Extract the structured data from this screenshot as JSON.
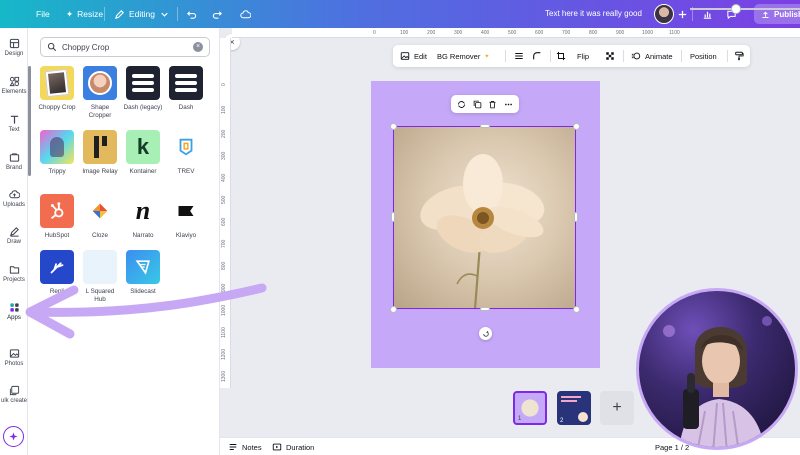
{
  "topbar": {
    "file": "File",
    "resize": "Resize",
    "editing": "Editing",
    "title": "Text here it was really good",
    "publish": "Publish as"
  },
  "rail": {
    "items": [
      {
        "label": "Design",
        "icon": "design-icon"
      },
      {
        "label": "Elements",
        "icon": "elements-icon"
      },
      {
        "label": "Text",
        "icon": "text-icon"
      },
      {
        "label": "Brand",
        "icon": "brand-icon"
      },
      {
        "label": "Uploads",
        "icon": "cloud-upload-icon"
      },
      {
        "label": "Draw",
        "icon": "pen-icon"
      },
      {
        "label": "Projects",
        "icon": "folder-icon"
      },
      {
        "label": "Apps",
        "icon": "apps-grid-icon"
      },
      {
        "label": "Photos",
        "icon": "image-icon"
      },
      {
        "label": "ulk create",
        "icon": "bulk-create-icon"
      }
    ]
  },
  "search": {
    "value": "Choppy Crop"
  },
  "apps": [
    {
      "name": "Choppy Crop"
    },
    {
      "name": "Shape Cropper"
    },
    {
      "name": "Dash (legacy)"
    },
    {
      "name": "Dash"
    },
    {
      "name": "Trippy"
    },
    {
      "name": "Image Relay"
    },
    {
      "name": "Kontainer"
    },
    {
      "name": "TREV"
    },
    {
      "name": "HubSpot"
    },
    {
      "name": "Cloze"
    },
    {
      "name": "Narrato"
    },
    {
      "name": "Klaviyo"
    },
    {
      "name": "Repli"
    },
    {
      "name": "L Squared Hub"
    },
    {
      "name": "Slidecast"
    }
  ],
  "ruler": {
    "top": [
      "0",
      "100",
      "200",
      "300",
      "400",
      "500",
      "600",
      "700",
      "800",
      "900",
      "1000",
      "1100"
    ],
    "left": [
      "0",
      "100",
      "200",
      "300",
      "400",
      "500",
      "600",
      "700",
      "800",
      "900",
      "1000",
      "1100",
      "1200",
      "1300"
    ]
  },
  "context_toolbar": {
    "edit": "Edit",
    "bg_remover": "BG Remover",
    "flip": "Flip",
    "animate": "Animate",
    "position": "Position"
  },
  "pages": [
    {
      "num": "1"
    },
    {
      "num": "2"
    }
  ],
  "bottombar": {
    "notes": "Notes",
    "duration": "Duration",
    "page": "Page 1 / 2"
  },
  "colors": {
    "accent": "#7d2ae8",
    "page_bg": "#c5a8f8",
    "arrow": "#c7a8f5"
  }
}
